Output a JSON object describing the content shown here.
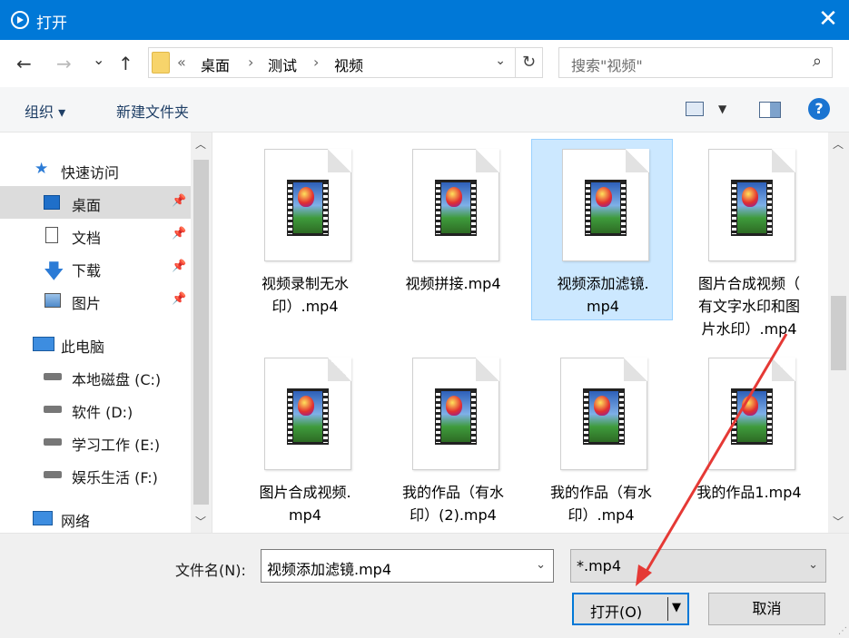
{
  "titlebar": {
    "title": "打开",
    "close": "✕"
  },
  "nav": {
    "back": "←",
    "forward": "→",
    "recent": "⌄",
    "up": "↑"
  },
  "address": {
    "overflow": "«",
    "crumbs": [
      "桌面",
      "测试",
      "视频"
    ],
    "separator": "›",
    "dropdown": "⌄",
    "refresh": "↻"
  },
  "search": {
    "placeholder": "搜索\"视频\"",
    "icon": "⌕"
  },
  "toolbar": {
    "organize": "组织 ▾",
    "new_folder": "新建文件夹",
    "view_dropdown": "▼",
    "help": "?"
  },
  "sidebar": {
    "items": [
      {
        "label": "快速访问",
        "icon": "star-icon"
      },
      {
        "label": "桌面",
        "icon": "desktop-icon",
        "pinned": true,
        "active": true
      },
      {
        "label": "文档",
        "icon": "document-icon",
        "pinned": true
      },
      {
        "label": "下载",
        "icon": "download-icon",
        "pinned": true
      },
      {
        "label": "图片",
        "icon": "pictures-icon",
        "pinned": true
      },
      {
        "label": "此电脑",
        "icon": "computer-icon"
      },
      {
        "label": "本地磁盘 (C:)",
        "icon": "drive-icon"
      },
      {
        "label": "软件 (D:)",
        "icon": "drive-icon"
      },
      {
        "label": "学习工作 (E:)",
        "icon": "drive-icon"
      },
      {
        "label": "娱乐生活 (F:)",
        "icon": "drive-icon"
      },
      {
        "label": "网络",
        "icon": "network-icon"
      }
    ],
    "pin_glyph": "📌"
  },
  "files": [
    {
      "name": "视频录制无水印）.mp4",
      "selected": false
    },
    {
      "name": "视频拼接.mp4",
      "selected": false
    },
    {
      "name": "视频添加滤镜.mp4",
      "selected": true
    },
    {
      "name": "图片合成视频（有文字水印和图片水印）.mp4",
      "selected": false
    },
    {
      "name": "图片合成视频.mp4",
      "selected": false
    },
    {
      "name": "我的作品（有水印）(2).mp4",
      "selected": false
    },
    {
      "name": "我的作品（有水印）.mp4",
      "selected": false
    },
    {
      "name": "我的作品1.mp4",
      "selected": false
    }
  ],
  "file_lines": [
    [
      "视频录制无水",
      "印）.mp4"
    ],
    [
      "视频拼接.mp4"
    ],
    [
      "视频添加滤镜.",
      "mp4"
    ],
    [
      "图片合成视频（",
      "有文字水印和图",
      "片水印）.mp4"
    ],
    [
      "图片合成视频.",
      "mp4"
    ],
    [
      "我的作品（有水",
      "印）(2).mp4"
    ],
    [
      "我的作品（有水",
      "印）.mp4"
    ],
    [
      "我的作品1.mp4"
    ]
  ],
  "bottom": {
    "filename_label": "文件名(N):",
    "filename_value": "视频添加滤镜.mp4",
    "filetype_value": "*.mp4",
    "open_label": "打开(O)",
    "cancel_label": "取消",
    "dropdown": "⌄"
  },
  "colors": {
    "accent": "#0078d7",
    "selection": "#cce8ff",
    "annotation": "#e53935"
  }
}
